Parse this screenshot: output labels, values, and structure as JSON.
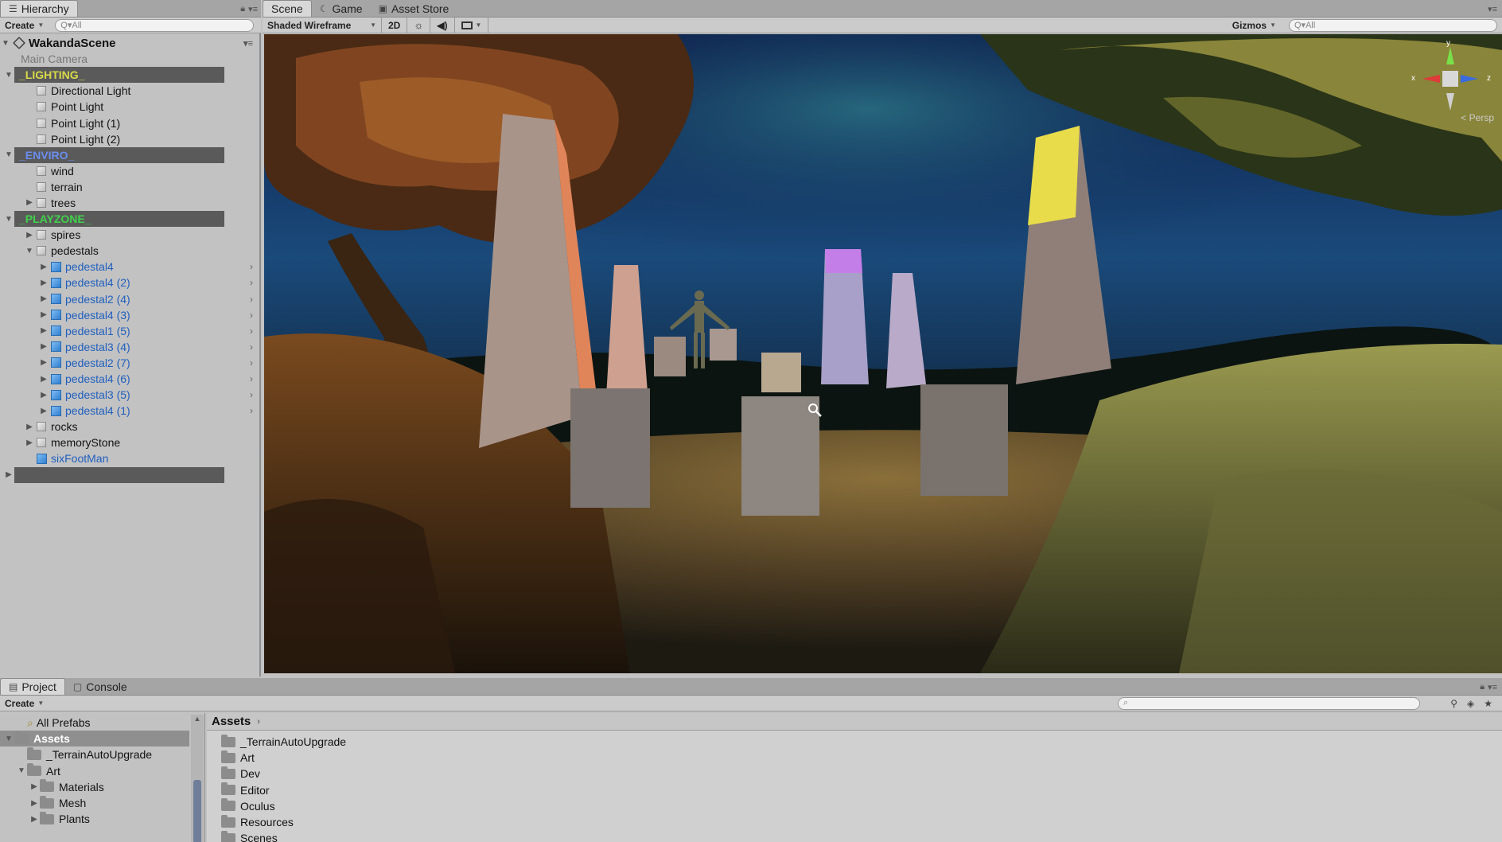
{
  "hierarchy": {
    "tab_label": "Hierarchy",
    "create_label": "Create",
    "search_placeholder": "Q▾All",
    "scene_name": "WakandaScene",
    "rows": [
      {
        "label": "Main Camera",
        "indent": 1,
        "arrow": "",
        "icon": "none",
        "kind": "dim"
      },
      {
        "label": "_LIGHTING_",
        "indent": 0,
        "arrow": "▼",
        "icon": "none",
        "kind": "header",
        "color": "#d9d94a"
      },
      {
        "label": "Directional Light",
        "indent": 2,
        "arrow": "",
        "icon": "cube",
        "kind": "normal"
      },
      {
        "label": "Point Light",
        "indent": 2,
        "arrow": "",
        "icon": "cube",
        "kind": "normal"
      },
      {
        "label": "Point Light (1)",
        "indent": 2,
        "arrow": "",
        "icon": "cube",
        "kind": "normal"
      },
      {
        "label": "Point Light (2)",
        "indent": 2,
        "arrow": "",
        "icon": "cube",
        "kind": "normal"
      },
      {
        "label": "_ENVIRO_",
        "indent": 0,
        "arrow": "▼",
        "icon": "none",
        "kind": "header",
        "color": "#6a8df0"
      },
      {
        "label": "wind",
        "indent": 2,
        "arrow": "",
        "icon": "cube",
        "kind": "normal"
      },
      {
        "label": "terrain",
        "indent": 2,
        "arrow": "",
        "icon": "cube",
        "kind": "normal"
      },
      {
        "label": "trees",
        "indent": 2,
        "arrow": "▶",
        "icon": "cube",
        "kind": "normal"
      },
      {
        "label": "_PLAYZONE_",
        "indent": 0,
        "arrow": "▼",
        "icon": "none",
        "kind": "header",
        "color": "#3fd24a"
      },
      {
        "label": "spires",
        "indent": 2,
        "arrow": "▶",
        "icon": "cube",
        "kind": "normal"
      },
      {
        "label": "pedestals",
        "indent": 2,
        "arrow": "▼",
        "icon": "cube",
        "kind": "normal"
      },
      {
        "label": "pedestal4",
        "indent": 3,
        "arrow": "▶",
        "icon": "prefab",
        "kind": "prefab"
      },
      {
        "label": "pedestal4 (2)",
        "indent": 3,
        "arrow": "▶",
        "icon": "prefab",
        "kind": "prefab"
      },
      {
        "label": "pedestal2 (4)",
        "indent": 3,
        "arrow": "▶",
        "icon": "prefab",
        "kind": "prefab"
      },
      {
        "label": "pedestal4 (3)",
        "indent": 3,
        "arrow": "▶",
        "icon": "prefab",
        "kind": "prefab"
      },
      {
        "label": "pedestal1 (5)",
        "indent": 3,
        "arrow": "▶",
        "icon": "prefab",
        "kind": "prefab"
      },
      {
        "label": "pedestal3 (4)",
        "indent": 3,
        "arrow": "▶",
        "icon": "prefab",
        "kind": "prefab"
      },
      {
        "label": "pedestal2 (7)",
        "indent": 3,
        "arrow": "▶",
        "icon": "prefab",
        "kind": "prefab"
      },
      {
        "label": "pedestal4 (6)",
        "indent": 3,
        "arrow": "▶",
        "icon": "prefab",
        "kind": "prefab"
      },
      {
        "label": "pedestal3 (5)",
        "indent": 3,
        "arrow": "▶",
        "icon": "prefab",
        "kind": "prefab"
      },
      {
        "label": "pedestal4 (1)",
        "indent": 3,
        "arrow": "▶",
        "icon": "prefab",
        "kind": "prefab"
      },
      {
        "label": "rocks",
        "indent": 2,
        "arrow": "▶",
        "icon": "cube",
        "kind": "normal"
      },
      {
        "label": "memoryStone",
        "indent": 2,
        "arrow": "▶",
        "icon": "cube",
        "kind": "normal"
      },
      {
        "label": "sixFootMan",
        "indent": 2,
        "arrow": "",
        "icon": "prefab",
        "kind": "prefab"
      },
      {
        "label": "",
        "indent": 0,
        "arrow": "▶",
        "icon": "none",
        "kind": "header",
        "color": "#e04040"
      }
    ]
  },
  "scene": {
    "tabs": [
      {
        "label": "Scene",
        "icon": "",
        "active": true
      },
      {
        "label": "Game",
        "icon": "☾",
        "active": false
      },
      {
        "label": "Asset Store",
        "icon": "▣",
        "active": false
      }
    ],
    "shading_mode": "Shaded Wireframe",
    "mode_2d": "2D",
    "gizmos_label": "Gizmos",
    "search_placeholder": "Q▾All",
    "persp_label": "Persp",
    "axis_x": "x",
    "axis_y": "y",
    "axis_z": "z"
  },
  "project": {
    "tabs": [
      {
        "label": "Project",
        "active": true
      },
      {
        "label": "Console",
        "active": false
      }
    ],
    "create_label": "Create",
    "tree": [
      {
        "label": "All Prefabs",
        "indent": 1,
        "arrow": "",
        "type": "search",
        "header": false
      },
      {
        "label": "Assets",
        "indent": 0,
        "arrow": "▼",
        "type": "folder",
        "header": true
      },
      {
        "label": "_TerrainAutoUpgrade",
        "indent": 1,
        "arrow": "",
        "type": "folder",
        "header": false
      },
      {
        "label": "Art",
        "indent": 1,
        "arrow": "▼",
        "type": "folder",
        "header": false
      },
      {
        "label": "Materials",
        "indent": 2,
        "arrow": "▶",
        "type": "folder",
        "header": false
      },
      {
        "label": "Mesh",
        "indent": 2,
        "arrow": "▶",
        "type": "folder",
        "header": false
      },
      {
        "label": "Plants",
        "indent": 2,
        "arrow": "▶",
        "type": "folder",
        "header": false
      }
    ],
    "breadcrumb": "Assets",
    "items": [
      "_TerrainAutoUpgrade",
      "Art",
      "Dev",
      "Editor",
      "Oculus",
      "Resources",
      "Scenes"
    ]
  }
}
